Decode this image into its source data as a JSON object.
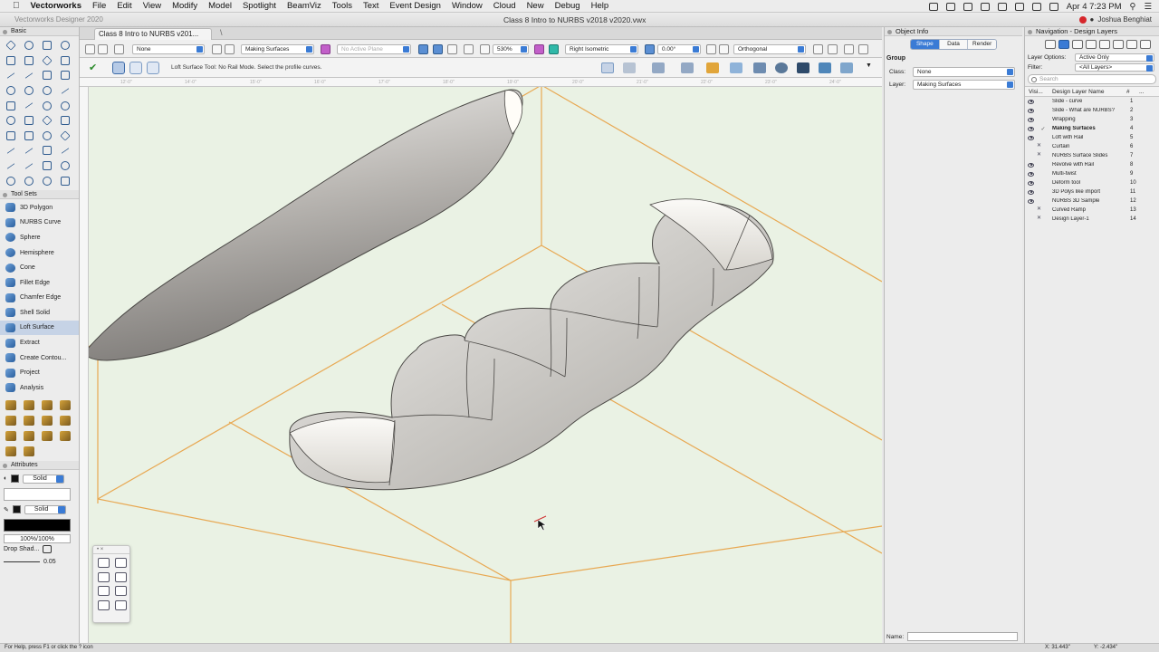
{
  "menubar": {
    "app_name": "Vectorworks",
    "items": [
      "File",
      "Edit",
      "View",
      "Modify",
      "Model",
      "Spotlight",
      "BeamViz",
      "Tools",
      "Text",
      "Event Design",
      "Window",
      "Cloud",
      "New",
      "Debug",
      "Help"
    ],
    "clock": "Apr 4  7:23 PM"
  },
  "window": {
    "app_title": "Vectorworks Designer 2020",
    "doc_title": "Class 8 Intro to NURBS v2018 v2020.vwx",
    "user": "Joshua Benghiat",
    "tab_label": "Class 8 Intro to NURBS v201..."
  },
  "left": {
    "basic_title": "Basic",
    "toolsets_title": "Tool Sets",
    "tools": [
      "3D Polygon",
      "NURBS Curve",
      "Sphere",
      "Hemisphere",
      "Cone",
      "Fillet Edge",
      "Chamfer Edge",
      "Shell Solid",
      "Loft Surface",
      "Extract",
      "Create Contou...",
      "Project",
      "Analysis"
    ],
    "selected_tool": "Loft Surface",
    "attributes_title": "Attributes",
    "fill_style": "Solid",
    "pen_style": "Solid",
    "opacity": "100%/100%",
    "drop_shadow": "Drop Shad...",
    "line_weight": "0.05"
  },
  "viewbar": {
    "class": "None",
    "layer": "Making Surfaces",
    "active_plane": "No Active Plane",
    "zoom": "530%",
    "view": "Right Isometric",
    "angle": "0.00°",
    "projection": "Orthogonal"
  },
  "modebar": {
    "hint": "Loft Surface Tool: No Rail Mode. Select the profile curves."
  },
  "rulers": {
    "top": [
      "12'-0\"",
      "14'-0\"",
      "15'-0\"",
      "16'-0\"",
      "17'-0\"",
      "18'-0\"",
      "19'-0\"",
      "20'-0\"",
      "21'-0\"",
      "22'-0\"",
      "23'-0\"",
      "24'-0\""
    ]
  },
  "object_info": {
    "title": "Object Info",
    "tabs": [
      "Shape",
      "Data",
      "Render"
    ],
    "selected_tab": "Shape",
    "group_label": "Group",
    "class_label": "Class:",
    "class_value": "None",
    "layer_label": "Layer:",
    "layer_value": "Making Surfaces",
    "name_label": "Name:"
  },
  "nav": {
    "title": "Navigation - Design Layers",
    "layer_options_label": "Layer Options:",
    "layer_options_value": "Active Only",
    "filter_label": "Filter:",
    "filter_value": "<All Layers>",
    "search_placeholder": "Search",
    "col_vis": "Visi...",
    "col_name": "Design Layer Name",
    "col_num": "#",
    "col_more": "...",
    "active_layer": "Making Surfaces",
    "layers": [
      {
        "name": "Slide - curve",
        "num": "1",
        "vis": "visible"
      },
      {
        "name": "Slide - What are NURBS?",
        "num": "2",
        "vis": "visible"
      },
      {
        "name": "Wrapping",
        "num": "3",
        "vis": "visible"
      },
      {
        "name": "Making Surfaces",
        "num": "4",
        "vis": "visible"
      },
      {
        "name": "Loft with Rail",
        "num": "5",
        "vis": "visible"
      },
      {
        "name": "Curtain",
        "num": "6",
        "vis": "hidden"
      },
      {
        "name": "NURBS Surface Slides",
        "num": "7",
        "vis": "hidden"
      },
      {
        "name": "Revolve with Rail",
        "num": "8",
        "vis": "visible"
      },
      {
        "name": "Multi-twist",
        "num": "9",
        "vis": "visible"
      },
      {
        "name": "Deform tool",
        "num": "10",
        "vis": "visible"
      },
      {
        "name": "3D Polys like import",
        "num": "11",
        "vis": "visible"
      },
      {
        "name": "NURBS 3D Sample",
        "num": "12",
        "vis": "visible"
      },
      {
        "name": "Curved Ramp",
        "num": "13",
        "vis": "hidden"
      },
      {
        "name": "Design Layer-1",
        "num": "14",
        "vis": "hidden"
      }
    ]
  },
  "statusbar": {
    "help": "For Help, press F1 or click the ? icon",
    "x": "X: 31.443\"",
    "y": "Y: -2.434\""
  },
  "colors": {
    "canvas_bg": "#eaf2e4",
    "grid_lines": "#e8a852",
    "accent": "#3a7bd5"
  }
}
